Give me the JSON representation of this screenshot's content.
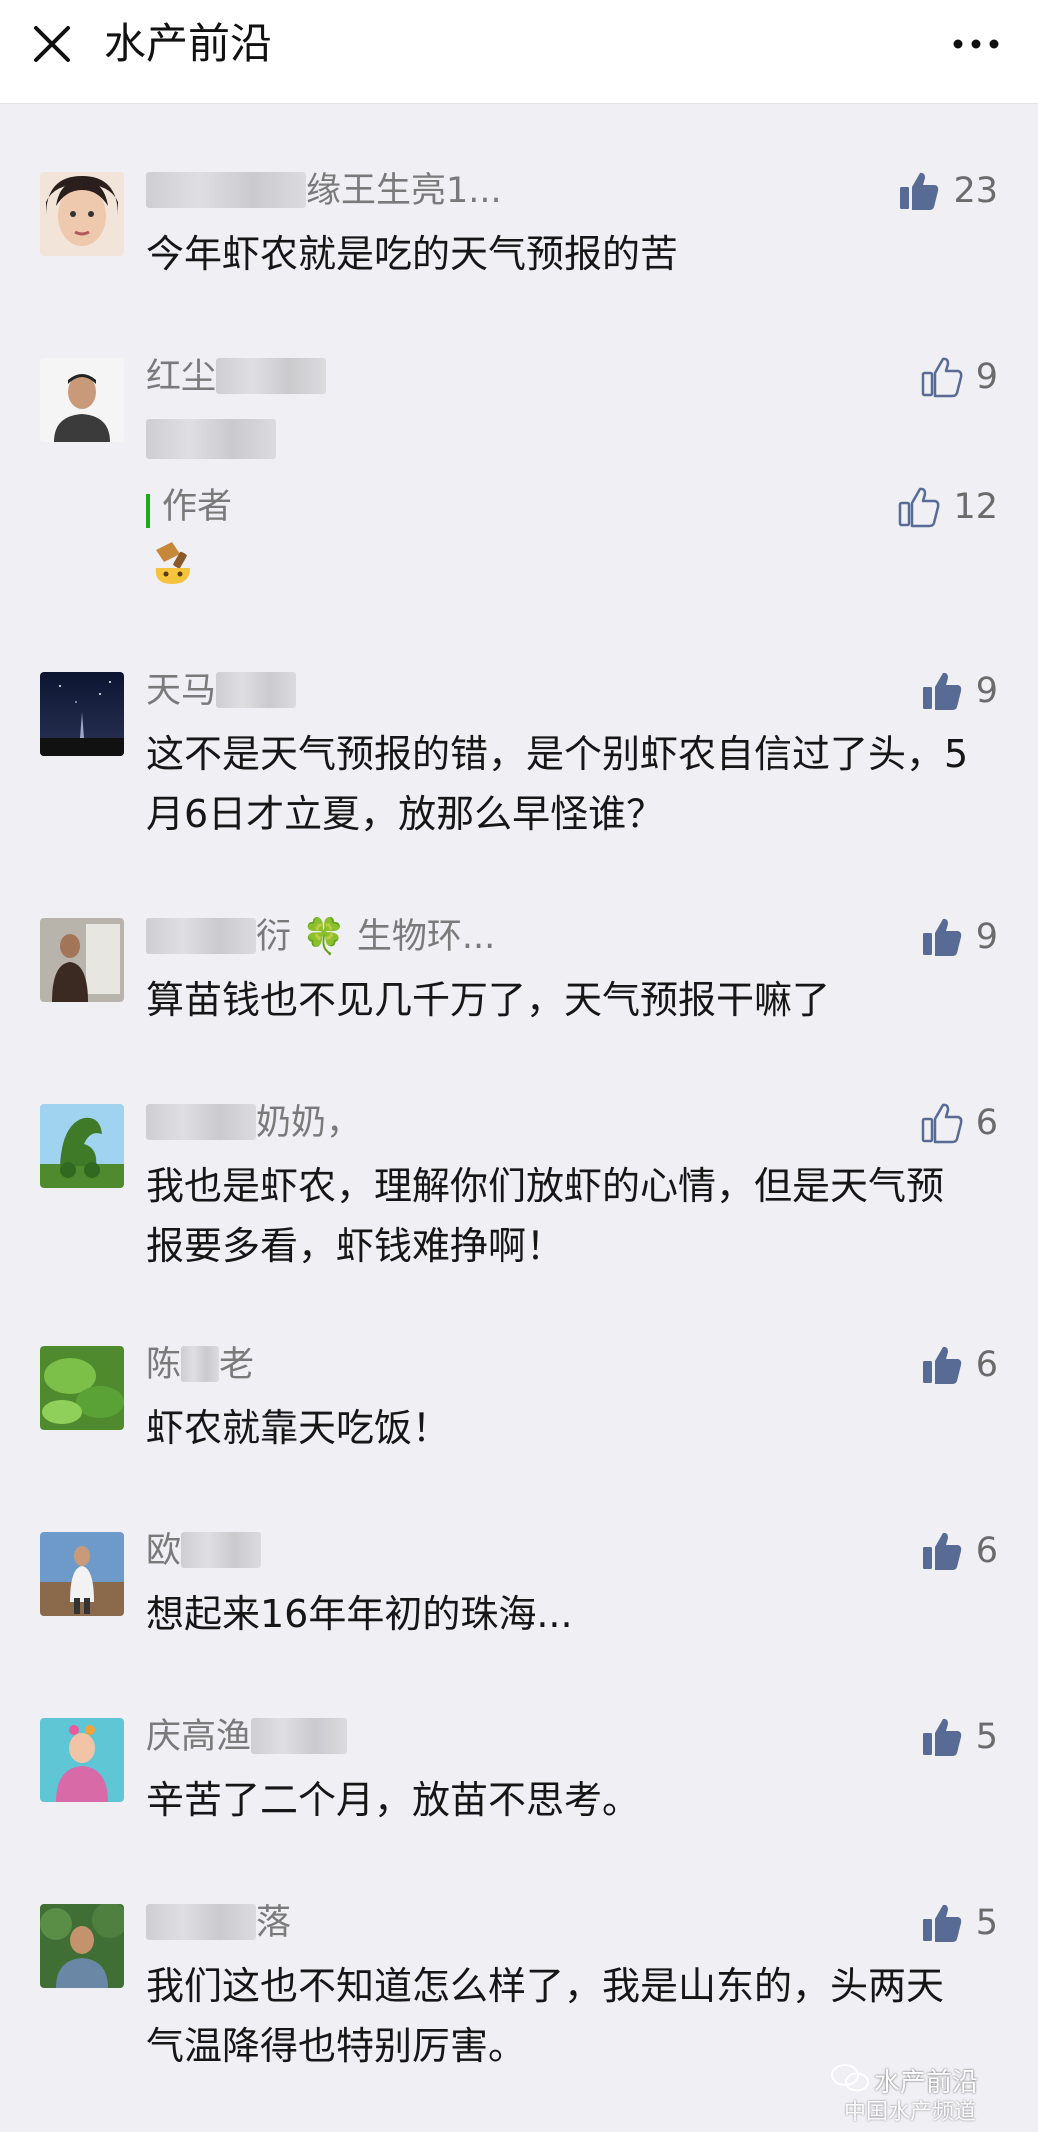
{
  "header": {
    "title": "水产前沿",
    "close_icon": "close-icon",
    "more_icon": "more-dots-icon"
  },
  "colors": {
    "liked_thumb": "#576b95",
    "outline_thumb": "#576b95",
    "author_bar": "#1aad19",
    "background": "#efeff4"
  },
  "comments": [
    {
      "name": "缘王生亮1...",
      "text": "今年虾农就是吃的天气预报的苦",
      "likes": "23",
      "liked": true
    },
    {
      "name": "红尘",
      "text": "",
      "likes": "9",
      "liked": false,
      "reply": {
        "author": "作者",
        "likes": "12",
        "liked": false,
        "emoji": "fist-emoji"
      }
    },
    {
      "name": "天马",
      "text": "这不是天气预报的错，是个别虾农自信过了头，5月6日才立夏，放那么早怪谁？",
      "likes": "9",
      "liked": true
    },
    {
      "name": "衍 🍀 生物环...",
      "text": "算苗钱也不见几千万了，天气预报干嘛了",
      "likes": "9",
      "liked": true
    },
    {
      "name": "奶奶，",
      "text": "我也是虾农，理解你们放虾的心情，但是天气预报要多看，虾钱难挣啊！",
      "likes": "6",
      "liked": false
    },
    {
      "name": "陈",
      "name_suffix": "老",
      "text": "虾农就靠天吃饭！",
      "likes": "6",
      "liked": true
    },
    {
      "name": "欧",
      "text": "想起来16年年初的珠海...",
      "likes": "6",
      "liked": true
    },
    {
      "name": "庆高渔",
      "text": "辛苦了二个月，放苗不思考。",
      "likes": "5",
      "liked": true
    },
    {
      "name": "落",
      "text": "我们这也不知道怎么样了，我是山东的，头两天气温降得也特别厉害。",
      "likes": "5",
      "liked": true
    }
  ],
  "watermark": {
    "name": "水产前沿",
    "sub": "中国水产频道"
  }
}
